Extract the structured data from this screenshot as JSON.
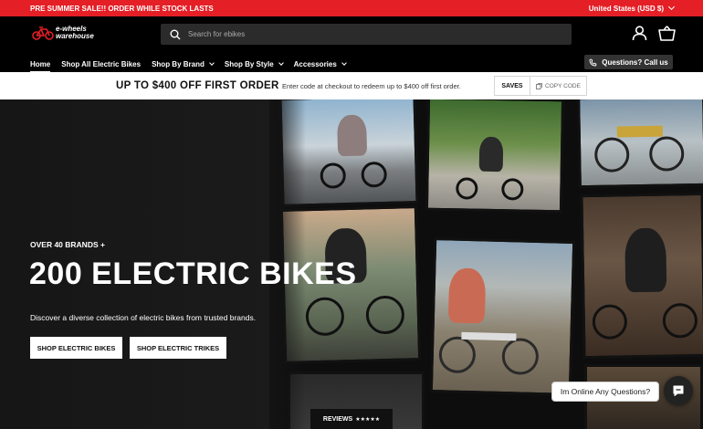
{
  "announcement": {
    "text": "PRE SUMMER SALE!! ORDER WHILE STOCK LASTS",
    "region": "United States (USD $)"
  },
  "brand": {
    "line1": "e-wheels",
    "line2": "warehouse",
    "accent_color": "#e41f26"
  },
  "search": {
    "placeholder": "Search for ebikes",
    "icon": "search-icon"
  },
  "header_icons": [
    "account-icon",
    "cart-icon"
  ],
  "nav": {
    "items": [
      {
        "label": "Home",
        "active": true,
        "dropdown": false
      },
      {
        "label": "Shop All Electric Bikes",
        "active": false,
        "dropdown": false
      },
      {
        "label": "Shop By Brand",
        "active": false,
        "dropdown": true
      },
      {
        "label": "Shop By Style",
        "active": false,
        "dropdown": true
      },
      {
        "label": "Accessories",
        "active": false,
        "dropdown": true
      }
    ],
    "call_label": "Questions? Call us"
  },
  "promo": {
    "title": "UP TO $400 OFF FIRST ORDER",
    "text": "Enter code at checkout to redeem up to $400 off first order.",
    "code": "SAVES",
    "copy_label": "COPY CODE"
  },
  "hero": {
    "eyebrow": "OVER 40 BRANDS +",
    "title": "200 ELECTRIC BIKES",
    "description": "Discover a diverse collection of electric bikes from trusted brands.",
    "buttons": [
      "SHOP ELECTRIC BIKES",
      "SHOP ELECTRIC TRIKES"
    ]
  },
  "reviews": {
    "label": "REVIEWS",
    "stars": "★★★★★"
  },
  "chat": {
    "bubble": "Im Online Any Questions?"
  }
}
